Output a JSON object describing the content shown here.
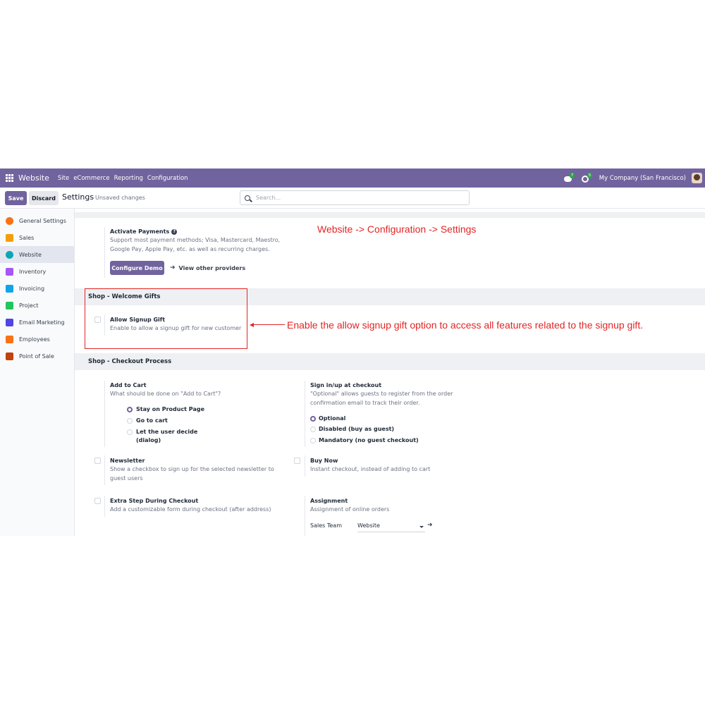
{
  "navbar": {
    "brand": "Website",
    "menu": [
      "Site",
      "eCommerce",
      "Reporting",
      "Configuration"
    ],
    "chat_count": "7",
    "activity_count": "5",
    "company": "My Company (San Francisco)"
  },
  "control": {
    "save_label": "Save",
    "discard_label": "Discard",
    "title": "Settings",
    "status": "Unsaved changes",
    "search_placeholder": "Search..."
  },
  "sidebar": {
    "items": [
      {
        "label": "General Settings",
        "color": "#f97316"
      },
      {
        "label": "Sales",
        "color": "#f59e0b"
      },
      {
        "label": "Website",
        "color": "#0ea5b7"
      },
      {
        "label": "Inventory",
        "color": "#a855f7"
      },
      {
        "label": "Invoicing",
        "color": "#0ea5e9"
      },
      {
        "label": "Project",
        "color": "#22c55e"
      },
      {
        "label": "Email Marketing",
        "color": "#4f46e5"
      },
      {
        "label": "Employees",
        "color": "#f97316"
      },
      {
        "label": "Point of Sale",
        "color": "#c2410c"
      }
    ]
  },
  "payments": {
    "title": "Activate Payments",
    "desc_line1": "Support most payment methods; Visa, Mastercard, Maestro,",
    "desc_line2": "Google Pay, Apple Pay, etc. as well as recurring charges.",
    "configure_label": "Configure Demo",
    "providers_label": "View other providers"
  },
  "welcome_gifts": {
    "header": "Shop - Welcome Gifts",
    "signup_title": "Allow Signup Gift",
    "signup_desc": "Enable to allow a signup gift for new customer"
  },
  "checkout": {
    "header": "Shop - Checkout Process",
    "add_to_cart": {
      "title": "Add to Cart",
      "desc": "What should be done on \"Add to Cart\"?",
      "options": [
        "Stay on Product Page",
        "Go to cart",
        "Let the user decide",
        "(dialog)"
      ],
      "selected": "Stay on Product Page"
    },
    "sign_in": {
      "title": "Sign in/up at checkout",
      "desc_line1": "\"Optional\" allows guests to register from the order",
      "desc_line2": "confirmation email to track their order.",
      "options": [
        "Optional",
        "Disabled (buy as guest)",
        "Mandatory (no guest checkout)"
      ],
      "selected": "Optional"
    },
    "newsletter": {
      "title": "Newsletter",
      "desc_line1": "Show a checkbox to sign up for the selected newsletter to",
      "desc_line2": "guest users"
    },
    "buy_now": {
      "title": "Buy Now",
      "desc": "Instant checkout, instead of adding to cart"
    },
    "extra_step": {
      "title": "Extra Step During Checkout",
      "desc": "Add a customizable form during checkout (after address)"
    },
    "assignment": {
      "title": "Assignment",
      "desc": "Assignment of online orders",
      "team_label": "Sales Team",
      "team_value": "Website"
    }
  },
  "annotations": {
    "breadcrumb": "Website -> Configuration -> Settings",
    "callout": "Enable the allow signup gift option to access all features related to the signup gift.",
    "color": "#e32525"
  }
}
